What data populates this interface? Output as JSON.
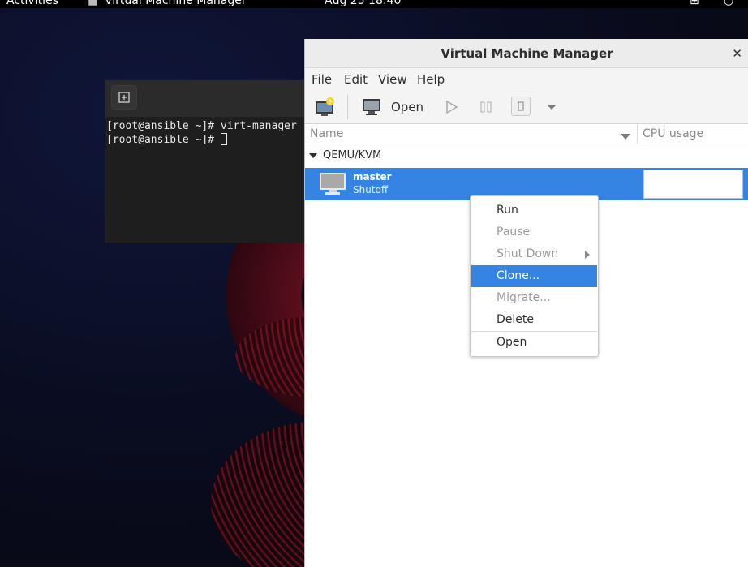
{
  "topbar": {
    "activities": "Activities",
    "app_name": "Virtual Machine Manager",
    "clock": "Aug 25  18:40"
  },
  "terminal": {
    "lines": [
      "[root@ansible ~]# virt-manager",
      "[root@ansible ~]# "
    ]
  },
  "vmm": {
    "title": "Virtual Machine Manager",
    "menu": [
      "File",
      "Edit",
      "View",
      "Help"
    ],
    "toolbar": {
      "open_label": "Open"
    },
    "columns": {
      "name": "Name",
      "cpu": "CPU usage"
    },
    "connection": "QEMU/KVM",
    "vm": {
      "name": "master",
      "state": "Shutoff"
    }
  },
  "context_menu": {
    "items": [
      {
        "label": "Run",
        "enabled": true
      },
      {
        "label": "Pause",
        "enabled": false
      },
      {
        "label": "Shut Down",
        "enabled": false,
        "submenu": true
      },
      {
        "label": "Clone...",
        "enabled": true,
        "highlighted": true
      },
      {
        "label": "Migrate...",
        "enabled": false
      },
      {
        "label": "Delete",
        "enabled": true
      },
      {
        "label": "Open",
        "enabled": true
      }
    ]
  },
  "colors": {
    "selection": "#3584e4",
    "terminal_bg": "#1e1e1e",
    "panel": "#000000"
  }
}
